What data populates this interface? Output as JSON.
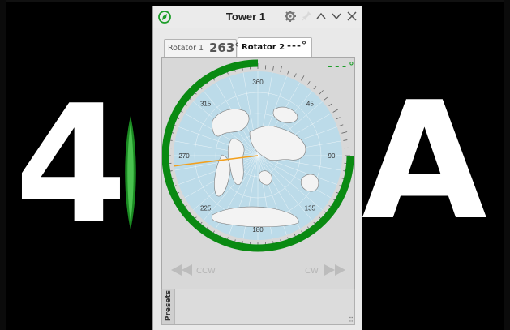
{
  "background": {
    "left_glyph": "4",
    "right_glyph": "A"
  },
  "window": {
    "title": "Tower 1",
    "icons": {
      "app": "compass-icon",
      "settings": "gear-icon",
      "pin": "pin-icon",
      "up": "chevron-up-icon",
      "down": "chevron-down-icon",
      "close": "close-icon"
    }
  },
  "tabs": [
    {
      "label": "Rotator 1",
      "value": "263°",
      "selected": false
    },
    {
      "label": "Rotator 2",
      "value": "---°",
      "selected": true
    }
  ],
  "rotator": {
    "readout": "---°",
    "heading_deg": 263,
    "compass_labels": [
      "360",
      "45",
      "90",
      "135",
      "180",
      "225",
      "270",
      "315"
    ],
    "arc_color": "#0a8a12",
    "beam_color": "#f2a01e",
    "map_color": "#bcdbe9"
  },
  "controls": {
    "ccw_label": "CCW",
    "cw_label": "CW"
  },
  "presets": {
    "label": "Presets"
  }
}
